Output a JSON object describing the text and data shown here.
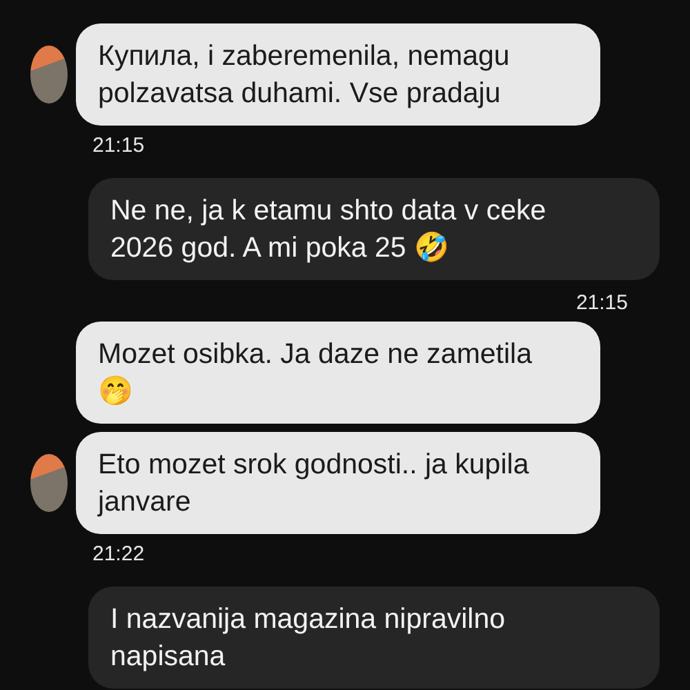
{
  "messages": [
    {
      "kind": "incoming",
      "avatar": true,
      "text": "Купила, i zaberemenila, nemagu polzavatsa duhami. Vse pradaju",
      "time": "21:15"
    },
    {
      "kind": "outgoing",
      "avatar": false,
      "text": "Ne ne, ja k etamu shto data v ceke 2026 god. A mi poka 25 🤣",
      "time": "21:15"
    },
    {
      "kind": "incoming",
      "avatar": false,
      "text": "Mozet osibka. Ja daze ne zametila 🤭"
    },
    {
      "kind": "incoming",
      "avatar": true,
      "text": "Eto mozet srok godnosti.. ja kupila janvare",
      "time": "21:22"
    },
    {
      "kind": "outgoing",
      "avatar": false,
      "text": "I nazvanija magazina nipravilno napisana"
    }
  ]
}
